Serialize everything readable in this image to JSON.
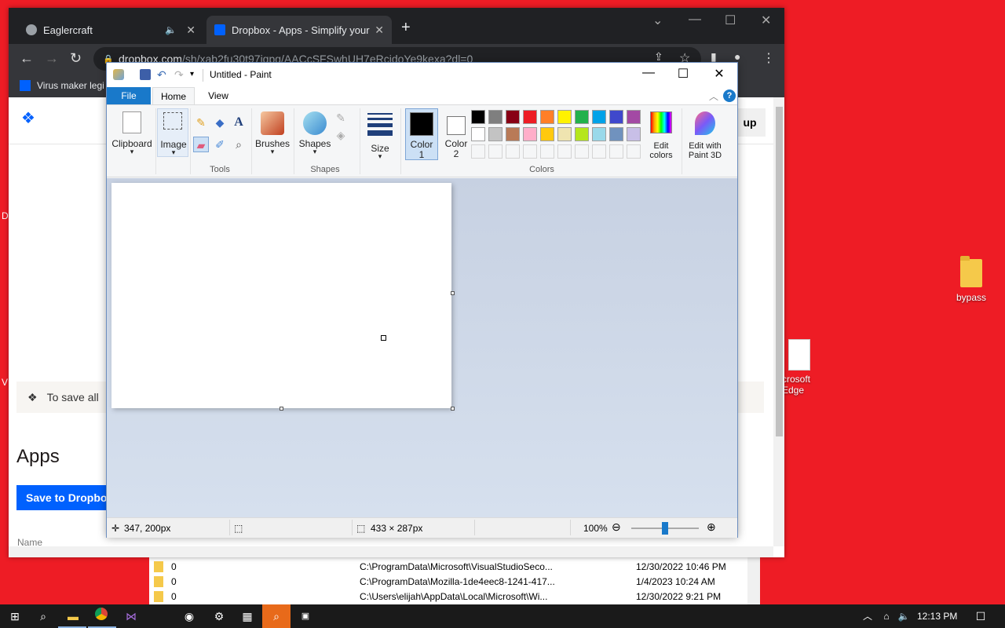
{
  "desktop": {
    "icons": [
      {
        "label": "bypass"
      },
      {
        "label": "crosoft Edge"
      }
    ],
    "left_fragments": [
      "D",
      "V"
    ]
  },
  "chrome": {
    "tabs": [
      {
        "title": "Eaglercraft",
        "audio": "🔈",
        "close": "✕"
      },
      {
        "title": "Dropbox - Apps - Simplify your li",
        "close": "✕"
      }
    ],
    "new_tab": "+",
    "url_host": "dropbox.com",
    "url_path": "/sh/xab2fu30t97iqpg/AACcSFSwhUH7eRcjdoYe9kexa?dl=0",
    "bookmark": "Virus maker legi",
    "page": {
      "banner_text": "To save all",
      "heading": "Apps",
      "save_button": "Save to Dropbo",
      "col_name": "Name",
      "signup_fragment": "up"
    }
  },
  "explorer": {
    "rows": [
      {
        "name": "0",
        "path": "C:\\ProgramData\\Microsoft\\VisualStudioSeco...",
        "date": "12/30/2022 10:46 PM"
      },
      {
        "name": "0",
        "path": "C:\\ProgramData\\Mozilla-1de4eec8-1241-417...",
        "date": "1/4/2023 10:24 AM"
      },
      {
        "name": "0",
        "path": "C:\\Users\\elijah\\AppData\\Local\\Microsoft\\Wi...",
        "date": "12/30/2022 9:21 PM"
      }
    ]
  },
  "paint": {
    "title": "Untitled - Paint",
    "tabs": {
      "file": "File",
      "home": "Home",
      "view": "View"
    },
    "help": "?",
    "groups": {
      "clipboard": "Clipboard",
      "image": "Image",
      "tools": "Tools",
      "brushes": "Brushes",
      "shapes_btn": "Shapes",
      "shapes": "Shapes",
      "size": "Size",
      "color1": "Color\n1",
      "color1_a": "Color",
      "color1_b": "1",
      "color2_a": "Color",
      "color2_b": "2",
      "colors": "Colors",
      "edit_colors_a": "Edit",
      "edit_colors_b": "colors",
      "paint3d_a": "Edit with",
      "paint3d_b": "Paint 3D"
    },
    "palette_row1": [
      "#000000",
      "#7f7f7f",
      "#880015",
      "#ed1c24",
      "#ff7f27",
      "#fff200",
      "#22b14c",
      "#00a2e8",
      "#3f48cc",
      "#a349a4"
    ],
    "palette_row2": [
      "#ffffff",
      "#c3c3c3",
      "#b97a57",
      "#ffaec9",
      "#ffc90e",
      "#efe4b0",
      "#b5e61d",
      "#99d9ea",
      "#7092be",
      "#c8bfe7"
    ],
    "color1": "#000000",
    "color2": "#ffffff",
    "status": {
      "cursor": "347, 200px",
      "size": "433 × 287px",
      "zoom": "100%",
      "zoom_level": 0.5
    }
  },
  "taskbar": {
    "time": "12:13 PM"
  }
}
